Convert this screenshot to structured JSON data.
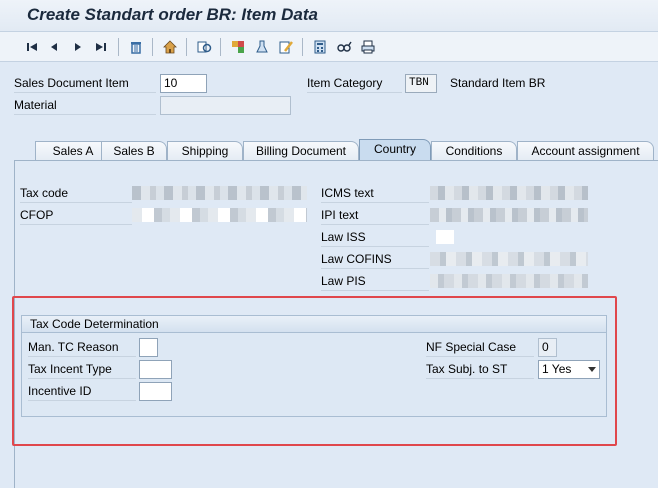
{
  "window": {
    "title": "Create Standart order BR: Item Data"
  },
  "toolbar": {
    "buttons": [
      {
        "name": "first-page-icon",
        "glyph": "⏮"
      },
      {
        "name": "previous-page-icon",
        "glyph": "◀"
      },
      {
        "name": "next-page-icon",
        "glyph": "▶"
      },
      {
        "name": "last-page-icon",
        "glyph": "⏭"
      },
      {
        "name": "delete-icon",
        "glyph": "🗑"
      },
      {
        "name": "header-icon",
        "glyph": "⌂"
      },
      {
        "name": "overview-icon",
        "glyph": "◎"
      },
      {
        "name": "configuration-icon",
        "glyph": "⚙"
      },
      {
        "name": "analysis-icon",
        "glyph": "⚗"
      },
      {
        "name": "edit-icon",
        "glyph": "✎"
      },
      {
        "name": "calculator-icon",
        "glyph": "▦"
      },
      {
        "name": "glasses-icon",
        "glyph": "∞"
      },
      {
        "name": "print-icon",
        "glyph": "⎙"
      }
    ]
  },
  "header": {
    "sales_doc_item_label": "Sales Document Item",
    "sales_doc_item_value": "10",
    "material_label": "Material",
    "material_value": "",
    "item_category_label": "Item Category",
    "item_category_code": "TBN",
    "item_category_text": "Standard Item BR"
  },
  "tabs": [
    {
      "label": "Sales A",
      "active": false
    },
    {
      "label": "Sales B",
      "active": false
    },
    {
      "label": "Shipping",
      "active": false
    },
    {
      "label": "Billing Document",
      "active": false
    },
    {
      "label": "Country",
      "active": true
    },
    {
      "label": "Conditions",
      "active": false
    },
    {
      "label": "Account assignment",
      "active": false
    }
  ],
  "country_tab": {
    "tax_code_label": "Tax code",
    "cfop_label": "CFOP",
    "icms_text_label": "ICMS text",
    "ipi_text_label": "IPI text",
    "law_iss_label": "Law ISS",
    "law_cofins_label": "Law COFINS",
    "law_pis_label": "Law PIS"
  },
  "tax_code_determination": {
    "title": "Tax Code Determination",
    "man_tc_reason_label": "Man. TC Reason",
    "man_tc_reason_value": "",
    "tax_incent_type_label": "Tax Incent Type",
    "tax_incent_type_value": "",
    "incentive_id_label": "Incentive ID",
    "incentive_id_value": "",
    "nf_special_case_label": "NF Special Case",
    "nf_special_case_value": "0",
    "tax_subj_st_label": "Tax Subj. to ST",
    "tax_subj_st_value": "1 Yes"
  },
  "colors": {
    "highlight_box": "#e0474c",
    "active_tab": "#c9dcef",
    "background": "#dfe9f5"
  }
}
